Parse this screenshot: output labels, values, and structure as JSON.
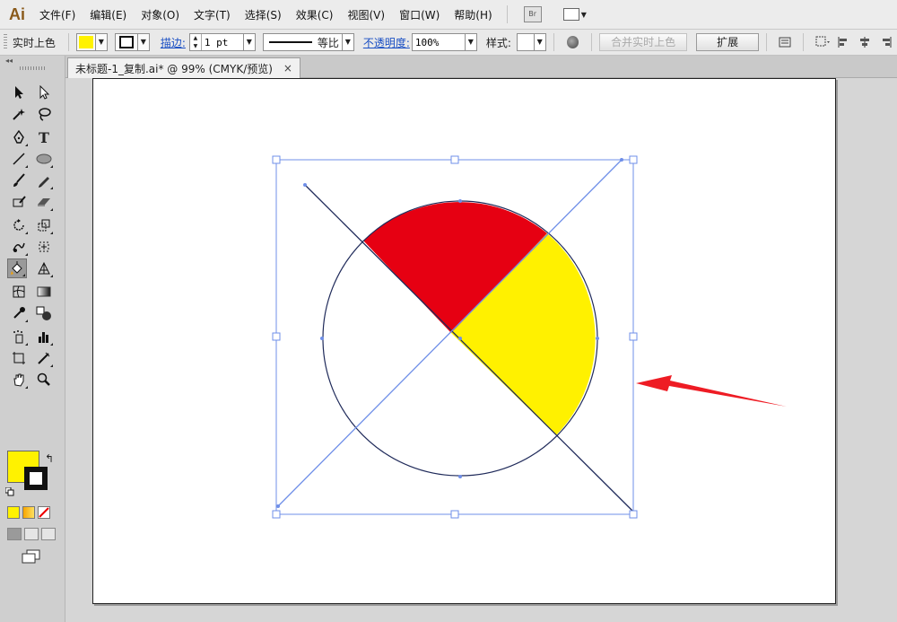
{
  "app": {
    "logo": "Ai"
  },
  "menu": [
    "文件(F)",
    "编辑(E)",
    "对象(O)",
    "文字(T)",
    "选择(S)",
    "效果(C)",
    "视图(V)",
    "窗口(W)",
    "帮助(H)"
  ],
  "menu_extras": {
    "bridge_label": "Br"
  },
  "control": {
    "mode_label": "实时上色",
    "fill_color": "#fff200",
    "stroke_label": "描边:",
    "stroke_weight": "1 pt",
    "profile_label": "等比",
    "opacity_label": "不透明度:",
    "opacity_value": "100%",
    "style_label": "样式:",
    "merge_button": "合并实时上色",
    "expand_button": "扩展"
  },
  "document": {
    "tab_title": "未标题-1_复制.ai* @ 99% (CMYK/预览)",
    "close_glyph": "×"
  },
  "toolbox": {
    "collapse_glyph": "◂◂",
    "fill_color": "#fff200",
    "stroke_color": "#111111",
    "text_tool_glyph": "T",
    "swap_glyph": "↰"
  },
  "artwork": {
    "red_fill": "#e60012",
    "yellow_fill": "#fff100",
    "arrow_color": "#ee1c24",
    "selection_color": "#6f8fe8"
  }
}
